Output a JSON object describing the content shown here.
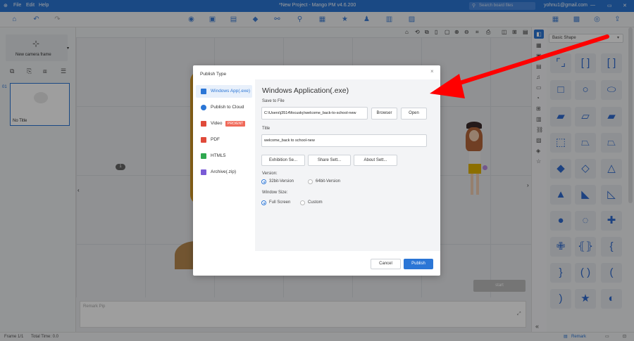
{
  "app": {
    "menu": [
      "File",
      "Edit",
      "Help"
    ],
    "title": "*New Project - Mango PM  v4.6.200",
    "search_placeholder": "Search board files",
    "user_email": "yohnu1@gmail.com"
  },
  "left_panel": {
    "camera_label": "New camera frame",
    "slide_number": "01",
    "slide_title": "No Title"
  },
  "canvas": {
    "remark_placeholder": "Remark Pip",
    "stage_badge": "1",
    "start_button": "start"
  },
  "shape_panel": {
    "dropdown_value": "Basic Shape"
  },
  "statusbar": {
    "frame": "Frame 1/1",
    "total_time": "Total Time: 0.0",
    "remark": "Remark"
  },
  "dialog": {
    "header": "Publish Type",
    "nav": [
      {
        "label": "Windows App(.exe)",
        "color": "#2b76d6"
      },
      {
        "label": "Publish to Cloud",
        "color": "#2b76d6"
      },
      {
        "label": "Video",
        "color": "#e04a3a",
        "badge": "PRO/ENT"
      },
      {
        "label": "PDF",
        "color": "#e04a3a"
      },
      {
        "label": "HTML5",
        "color": "#2fa84f"
      },
      {
        "label": "Archive(.zip)",
        "color": "#7a5bd6"
      }
    ],
    "main_title": "Windows Application(.exe)",
    "save_to_file_label": "Save to File",
    "save_path": "C:\\Users\\j3514\\focusky\\welcome_back-to-school-new",
    "browser_button": "Browser",
    "open_button": "Open",
    "title_label": "Title",
    "title_value": "welcome_back to school-new",
    "exhibition_button": "Exhibition Se...",
    "share_button": "Share Sett...",
    "about_button": "About Sett...",
    "version_label": "Version:",
    "version_options": [
      "32bit-Version",
      "64bit-Version"
    ],
    "version_selected": "32bit-Version",
    "window_size_label": "Window Size:",
    "size_options": [
      "Full Screen",
      "Custom"
    ],
    "size_selected": "Full Screen",
    "cancel_button": "Cancel",
    "publish_button": "Publish"
  },
  "colors": {
    "accent": "#2b76d6",
    "arrow": "#ff0000"
  }
}
